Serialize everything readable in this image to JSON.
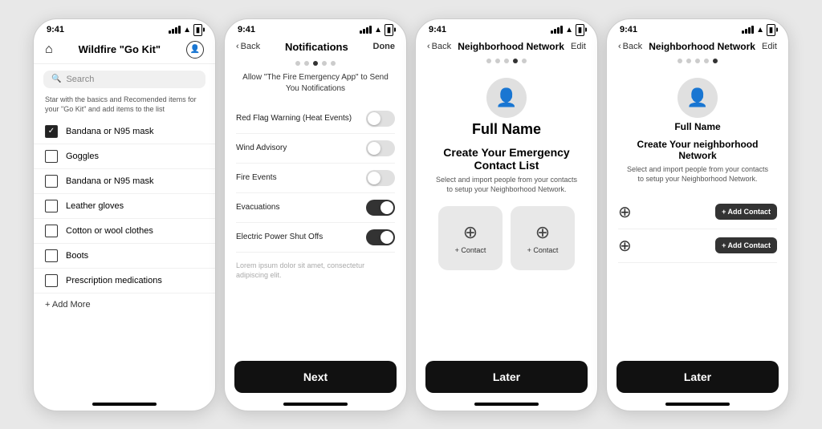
{
  "phone1": {
    "status": {
      "time": "9:41",
      "icons": "signal wifi battery"
    },
    "header": {
      "title": "Wildfire \"Go Kit\""
    },
    "search": {
      "placeholder": "Search"
    },
    "subtitle": "Star with  the basics and Recomended items for your \"Go Kit\" and add items to the list",
    "items": [
      {
        "label": "Bandana or N95 mask",
        "checked": true
      },
      {
        "label": "Goggles",
        "checked": false
      },
      {
        "label": "Bandana or N95 mask",
        "checked": false
      },
      {
        "label": "Leather gloves",
        "checked": false
      },
      {
        "label": "Cotton or wool clothes",
        "checked": false
      },
      {
        "label": "Boots",
        "checked": false
      },
      {
        "label": "Prescription medications",
        "checked": false
      }
    ],
    "add_more": "+ Add More"
  },
  "phone2": {
    "status": {
      "time": "9:41"
    },
    "header": {
      "back": "Back",
      "title": "Notifications",
      "done": "Done"
    },
    "dots": [
      false,
      false,
      true,
      false,
      false
    ],
    "description": "Allow \"The Fire Emergency App\" to Send You Notifications",
    "notifications": [
      {
        "label": "Red Flag Warning (Heat Events)",
        "on": false
      },
      {
        "label": "Wind Advisory",
        "on": false
      },
      {
        "label": "Fire Events",
        "on": false
      },
      {
        "label": "Evacuations",
        "on": true
      },
      {
        "label": "Electric Power Shut Offs",
        "on": true
      }
    ],
    "lorem": "Lorem ipsum dolor sit amet, consectetur adipiscing elit.",
    "next_label": "Next"
  },
  "phone3": {
    "status": {
      "time": "9:41"
    },
    "header": {
      "back": "Back",
      "title": "Neighborhood Network",
      "edit": "Edit"
    },
    "dots": [
      false,
      false,
      false,
      true,
      false
    ],
    "profile": {
      "name": "Full Name"
    },
    "section_title": "Create Your Emergency Contact List",
    "description": "Select and import people from your contacts to setup your Neighborhood Network.",
    "contacts": [
      {
        "label": "+ Contact"
      },
      {
        "label": "+ Contact"
      }
    ],
    "later_label": "Later"
  },
  "phone4": {
    "status": {
      "time": "9:41"
    },
    "header": {
      "back": "Back",
      "title": "Neighborhood Network",
      "edit": "Edit"
    },
    "dots": [
      false,
      false,
      false,
      false,
      true
    ],
    "profile": {
      "name": "Full Name"
    },
    "section_title": "Create Your neighborhood Network",
    "description": "Select and import people from your contacts to setup your Neighborhood Network.",
    "rows": [
      {
        "add_label": "+ Add Contact"
      },
      {
        "add_label": "+ Add Contact"
      }
    ],
    "later_label": "Later"
  }
}
